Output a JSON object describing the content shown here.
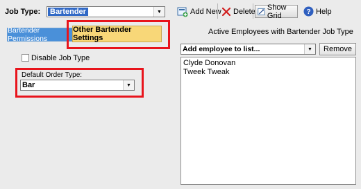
{
  "header": {
    "job_type_label": "Job Type:",
    "job_type_value": "Bartender"
  },
  "toolbar": {
    "add_label": "Add New",
    "delete_label": "Delete",
    "show_grid_label": "Show Grid",
    "help_label": "Help"
  },
  "tabs": [
    {
      "label": "Bartender Permissions",
      "selected": false
    },
    {
      "label": "Other Bartender Settings",
      "selected": true
    }
  ],
  "settings": {
    "disable_job_type_label": "Disable Job Type",
    "disable_job_type_checked": false,
    "default_order_type_label": "Default Order Type:",
    "default_order_type_value": "Bar"
  },
  "employees": {
    "title": "Active Employees with Bartender Job Type",
    "add_placeholder": "Add employee to list...",
    "remove_label": "Remove",
    "list": [
      "Clyde Donovan",
      "Tweek Tweak"
    ]
  },
  "colors": {
    "selected_tab": "#f8d778",
    "inactive_tab": "#4a90d9",
    "highlight": "#e8141c",
    "selection": "#3169c6"
  }
}
